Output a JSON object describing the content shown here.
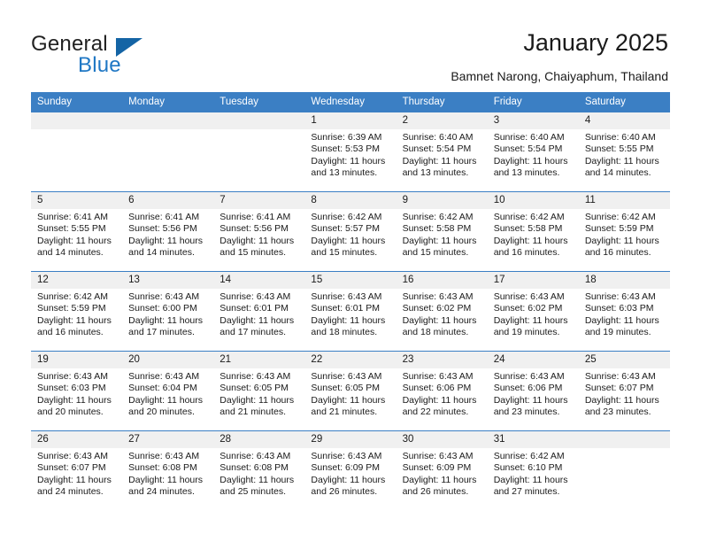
{
  "brand": {
    "name_part1": "General",
    "name_part2": "Blue",
    "triangle_color": "#1464a5",
    "blue_color": "#1f77c4"
  },
  "header": {
    "title": "January 2025",
    "subtitle": "Bamnet Narong, Chaiyaphum, Thailand"
  },
  "theme": {
    "header_blue": "#3b7fc4",
    "daynum_band": "#f0f0f0",
    "text": "#1a1a1a"
  },
  "weekdays": [
    "Sunday",
    "Monday",
    "Tuesday",
    "Wednesday",
    "Thursday",
    "Friday",
    "Saturday"
  ],
  "labels": {
    "sunrise_prefix": "Sunrise: ",
    "sunset_prefix": "Sunset: ",
    "daylight_prefix": "Daylight: "
  },
  "weeks": [
    [
      {
        "day": "",
        "sunrise": "",
        "sunset": "",
        "daylight_line1": "",
        "daylight_line2": ""
      },
      {
        "day": "",
        "sunrise": "",
        "sunset": "",
        "daylight_line1": "",
        "daylight_line2": ""
      },
      {
        "day": "",
        "sunrise": "",
        "sunset": "",
        "daylight_line1": "",
        "daylight_line2": ""
      },
      {
        "day": "1",
        "sunrise": "Sunrise: 6:39 AM",
        "sunset": "Sunset: 5:53 PM",
        "daylight_line1": "Daylight: 11 hours",
        "daylight_line2": "and 13 minutes."
      },
      {
        "day": "2",
        "sunrise": "Sunrise: 6:40 AM",
        "sunset": "Sunset: 5:54 PM",
        "daylight_line1": "Daylight: 11 hours",
        "daylight_line2": "and 13 minutes."
      },
      {
        "day": "3",
        "sunrise": "Sunrise: 6:40 AM",
        "sunset": "Sunset: 5:54 PM",
        "daylight_line1": "Daylight: 11 hours",
        "daylight_line2": "and 13 minutes."
      },
      {
        "day": "4",
        "sunrise": "Sunrise: 6:40 AM",
        "sunset": "Sunset: 5:55 PM",
        "daylight_line1": "Daylight: 11 hours",
        "daylight_line2": "and 14 minutes."
      }
    ],
    [
      {
        "day": "5",
        "sunrise": "Sunrise: 6:41 AM",
        "sunset": "Sunset: 5:55 PM",
        "daylight_line1": "Daylight: 11 hours",
        "daylight_line2": "and 14 minutes."
      },
      {
        "day": "6",
        "sunrise": "Sunrise: 6:41 AM",
        "sunset": "Sunset: 5:56 PM",
        "daylight_line1": "Daylight: 11 hours",
        "daylight_line2": "and 14 minutes."
      },
      {
        "day": "7",
        "sunrise": "Sunrise: 6:41 AM",
        "sunset": "Sunset: 5:56 PM",
        "daylight_line1": "Daylight: 11 hours",
        "daylight_line2": "and 15 minutes."
      },
      {
        "day": "8",
        "sunrise": "Sunrise: 6:42 AM",
        "sunset": "Sunset: 5:57 PM",
        "daylight_line1": "Daylight: 11 hours",
        "daylight_line2": "and 15 minutes."
      },
      {
        "day": "9",
        "sunrise": "Sunrise: 6:42 AM",
        "sunset": "Sunset: 5:58 PM",
        "daylight_line1": "Daylight: 11 hours",
        "daylight_line2": "and 15 minutes."
      },
      {
        "day": "10",
        "sunrise": "Sunrise: 6:42 AM",
        "sunset": "Sunset: 5:58 PM",
        "daylight_line1": "Daylight: 11 hours",
        "daylight_line2": "and 16 minutes."
      },
      {
        "day": "11",
        "sunrise": "Sunrise: 6:42 AM",
        "sunset": "Sunset: 5:59 PM",
        "daylight_line1": "Daylight: 11 hours",
        "daylight_line2": "and 16 minutes."
      }
    ],
    [
      {
        "day": "12",
        "sunrise": "Sunrise: 6:42 AM",
        "sunset": "Sunset: 5:59 PM",
        "daylight_line1": "Daylight: 11 hours",
        "daylight_line2": "and 16 minutes."
      },
      {
        "day": "13",
        "sunrise": "Sunrise: 6:43 AM",
        "sunset": "Sunset: 6:00 PM",
        "daylight_line1": "Daylight: 11 hours",
        "daylight_line2": "and 17 minutes."
      },
      {
        "day": "14",
        "sunrise": "Sunrise: 6:43 AM",
        "sunset": "Sunset: 6:01 PM",
        "daylight_line1": "Daylight: 11 hours",
        "daylight_line2": "and 17 minutes."
      },
      {
        "day": "15",
        "sunrise": "Sunrise: 6:43 AM",
        "sunset": "Sunset: 6:01 PM",
        "daylight_line1": "Daylight: 11 hours",
        "daylight_line2": "and 18 minutes."
      },
      {
        "day": "16",
        "sunrise": "Sunrise: 6:43 AM",
        "sunset": "Sunset: 6:02 PM",
        "daylight_line1": "Daylight: 11 hours",
        "daylight_line2": "and 18 minutes."
      },
      {
        "day": "17",
        "sunrise": "Sunrise: 6:43 AM",
        "sunset": "Sunset: 6:02 PM",
        "daylight_line1": "Daylight: 11 hours",
        "daylight_line2": "and 19 minutes."
      },
      {
        "day": "18",
        "sunrise": "Sunrise: 6:43 AM",
        "sunset": "Sunset: 6:03 PM",
        "daylight_line1": "Daylight: 11 hours",
        "daylight_line2": "and 19 minutes."
      }
    ],
    [
      {
        "day": "19",
        "sunrise": "Sunrise: 6:43 AM",
        "sunset": "Sunset: 6:03 PM",
        "daylight_line1": "Daylight: 11 hours",
        "daylight_line2": "and 20 minutes."
      },
      {
        "day": "20",
        "sunrise": "Sunrise: 6:43 AM",
        "sunset": "Sunset: 6:04 PM",
        "daylight_line1": "Daylight: 11 hours",
        "daylight_line2": "and 20 minutes."
      },
      {
        "day": "21",
        "sunrise": "Sunrise: 6:43 AM",
        "sunset": "Sunset: 6:05 PM",
        "daylight_line1": "Daylight: 11 hours",
        "daylight_line2": "and 21 minutes."
      },
      {
        "day": "22",
        "sunrise": "Sunrise: 6:43 AM",
        "sunset": "Sunset: 6:05 PM",
        "daylight_line1": "Daylight: 11 hours",
        "daylight_line2": "and 21 minutes."
      },
      {
        "day": "23",
        "sunrise": "Sunrise: 6:43 AM",
        "sunset": "Sunset: 6:06 PM",
        "daylight_line1": "Daylight: 11 hours",
        "daylight_line2": "and 22 minutes."
      },
      {
        "day": "24",
        "sunrise": "Sunrise: 6:43 AM",
        "sunset": "Sunset: 6:06 PM",
        "daylight_line1": "Daylight: 11 hours",
        "daylight_line2": "and 23 minutes."
      },
      {
        "day": "25",
        "sunrise": "Sunrise: 6:43 AM",
        "sunset": "Sunset: 6:07 PM",
        "daylight_line1": "Daylight: 11 hours",
        "daylight_line2": "and 23 minutes."
      }
    ],
    [
      {
        "day": "26",
        "sunrise": "Sunrise: 6:43 AM",
        "sunset": "Sunset: 6:07 PM",
        "daylight_line1": "Daylight: 11 hours",
        "daylight_line2": "and 24 minutes."
      },
      {
        "day": "27",
        "sunrise": "Sunrise: 6:43 AM",
        "sunset": "Sunset: 6:08 PM",
        "daylight_line1": "Daylight: 11 hours",
        "daylight_line2": "and 24 minutes."
      },
      {
        "day": "28",
        "sunrise": "Sunrise: 6:43 AM",
        "sunset": "Sunset: 6:08 PM",
        "daylight_line1": "Daylight: 11 hours",
        "daylight_line2": "and 25 minutes."
      },
      {
        "day": "29",
        "sunrise": "Sunrise: 6:43 AM",
        "sunset": "Sunset: 6:09 PM",
        "daylight_line1": "Daylight: 11 hours",
        "daylight_line2": "and 26 minutes."
      },
      {
        "day": "30",
        "sunrise": "Sunrise: 6:43 AM",
        "sunset": "Sunset: 6:09 PM",
        "daylight_line1": "Daylight: 11 hours",
        "daylight_line2": "and 26 minutes."
      },
      {
        "day": "31",
        "sunrise": "Sunrise: 6:42 AM",
        "sunset": "Sunset: 6:10 PM",
        "daylight_line1": "Daylight: 11 hours",
        "daylight_line2": "and 27 minutes."
      },
      {
        "day": "",
        "sunrise": "",
        "sunset": "",
        "daylight_line1": "",
        "daylight_line2": ""
      }
    ]
  ]
}
